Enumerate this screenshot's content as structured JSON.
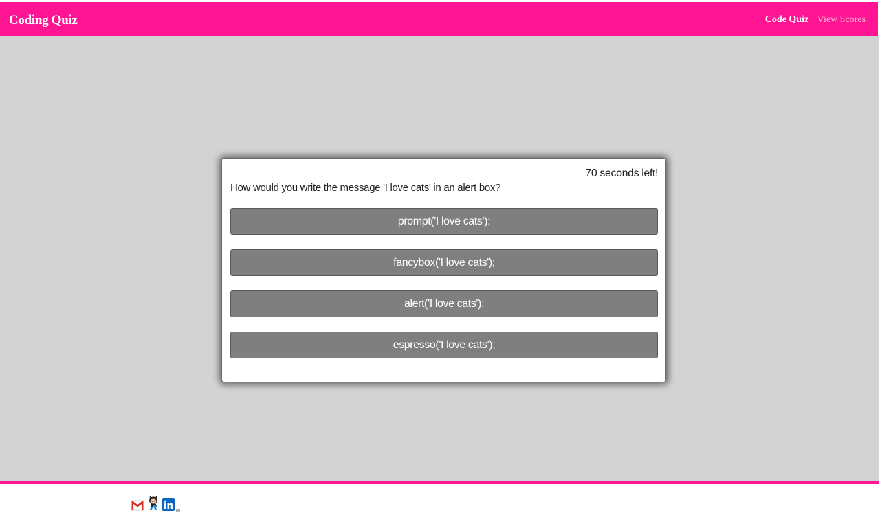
{
  "navbar": {
    "brand": "Coding Quiz",
    "links": [
      {
        "label": "Code Quiz",
        "active": true
      },
      {
        "label": "View Scores",
        "active": false
      }
    ],
    "color": "#ff1493"
  },
  "quiz": {
    "timer_text": "70 seconds left!",
    "question": "How would you write the message 'I love cats' in an alert box?",
    "answers": [
      "prompt('I love cats');",
      "fancybox('I love cats');",
      "alert('I love cats');",
      "espresso('I love cats');"
    ]
  },
  "footer": {
    "social": [
      {
        "icon": "gmail-icon"
      },
      {
        "icon": "github-octocat-icon"
      },
      {
        "icon": "linkedin-icon"
      }
    ],
    "tm": "TM"
  },
  "colors": {
    "accent": "#ff1493",
    "background": "#d3d3d3",
    "answer_bg": "#7f7f7f"
  }
}
